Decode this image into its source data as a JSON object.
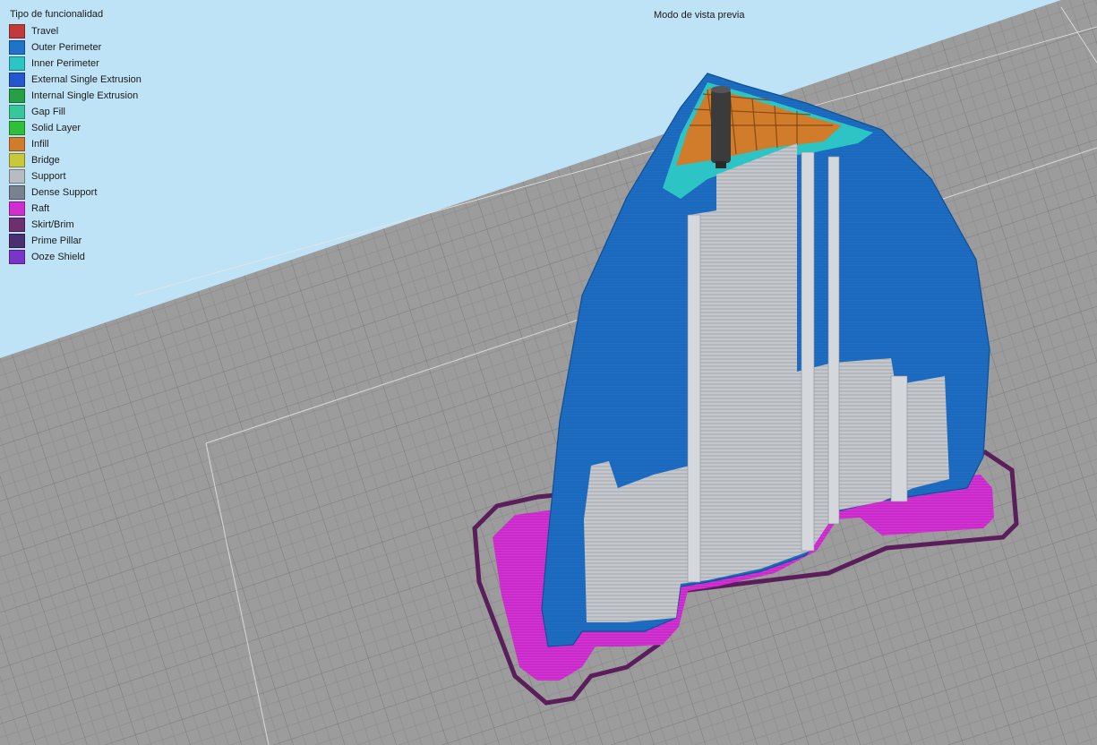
{
  "legend": {
    "title": "Tipo de funcionalidad",
    "items": [
      {
        "label": "Travel",
        "color": "#c23a3a"
      },
      {
        "label": "Outer Perimeter",
        "color": "#1f73c8"
      },
      {
        "label": "Inner Perimeter",
        "color": "#2cc4c4"
      },
      {
        "label": "External Single Extrusion",
        "color": "#2457cf"
      },
      {
        "label": "Internal Single Extrusion",
        "color": "#26a046"
      },
      {
        "label": "Gap Fill",
        "color": "#36c79a"
      },
      {
        "label": "Solid Layer",
        "color": "#2fbf3a"
      },
      {
        "label": "Infill",
        "color": "#d07c2a"
      },
      {
        "label": "Bridge",
        "color": "#c8c83a"
      },
      {
        "label": "Support",
        "color": "#b7bcc2"
      },
      {
        "label": "Dense Support",
        "color": "#7a838d"
      },
      {
        "label": "Raft",
        "color": "#cf2fcf"
      },
      {
        "label": "Skirt/Brim",
        "color": "#6e2f6e"
      },
      {
        "label": "Prime Pillar",
        "color": "#4b2f73"
      },
      {
        "label": "Ooze Shield",
        "color": "#7b34c9"
      }
    ]
  },
  "view": {
    "mode_title": "Modo de vista previa",
    "background_color": "#bfe3f6",
    "bed_color": "#9c9c9c",
    "grid_color": "#858585"
  }
}
